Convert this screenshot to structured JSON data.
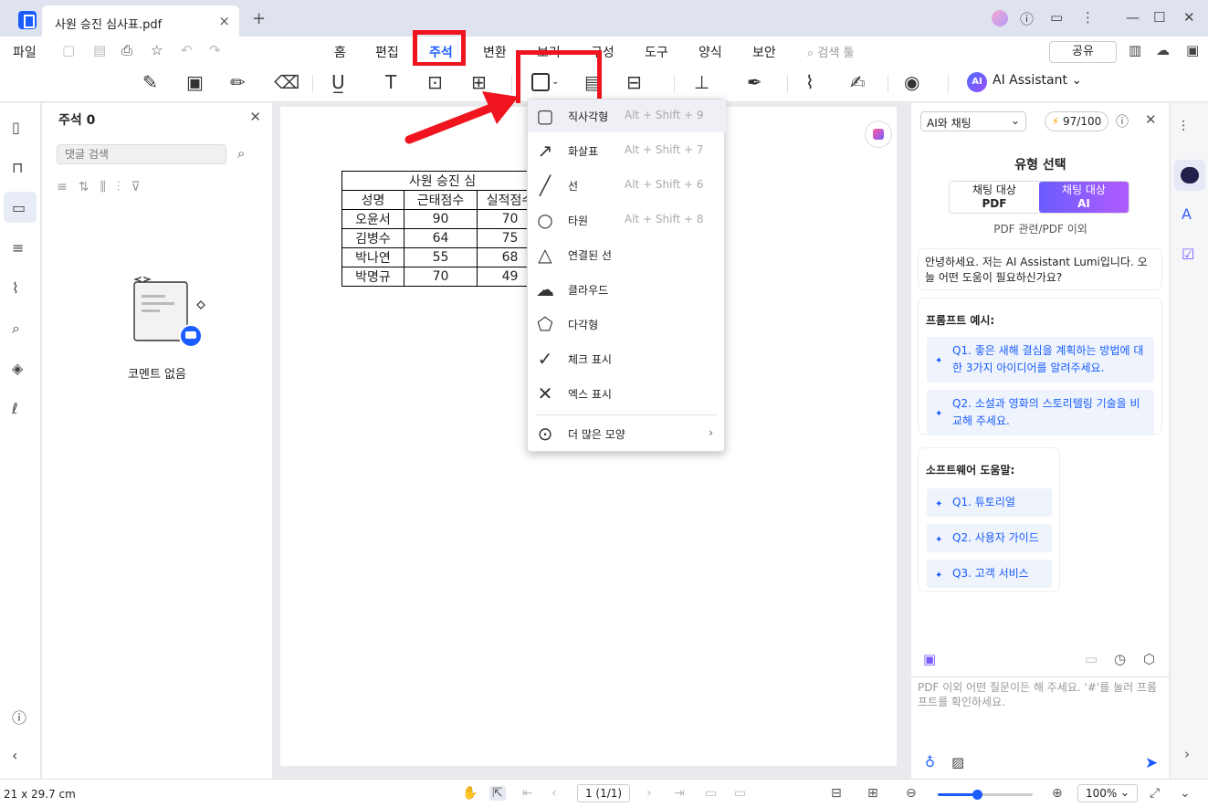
{
  "titlebar": {
    "tab_title": "사원 승진 심사표.pdf",
    "close": "×",
    "new_tab": "+"
  },
  "menubar": {
    "file": "파일",
    "items": [
      "홈",
      "편집",
      "주석",
      "변환",
      "보기",
      "구성",
      "도구",
      "양식",
      "보안"
    ],
    "active": "주석",
    "search_tools": "검색 툴",
    "share": "공유"
  },
  "toolbar": {
    "ai_assistant": "AI Assistant",
    "ai_badge": "AI"
  },
  "comments_panel": {
    "title": "주석 0",
    "search_placeholder": "댓글 검색",
    "empty_text": "코멘트 없음"
  },
  "document": {
    "table_title": "사원 승진 심",
    "headers": [
      "성명",
      "근태점수",
      "실적점수"
    ],
    "rows": [
      [
        "오윤서",
        "90",
        "70"
      ],
      [
        "김병수",
        "64",
        "75"
      ],
      [
        "박나연",
        "55",
        "68"
      ],
      [
        "박명규",
        "70",
        "49"
      ]
    ]
  },
  "shape_menu": {
    "items": [
      {
        "label": "직사각형",
        "shortcut": "Alt + Shift + 9",
        "icon": "rectangle-icon"
      },
      {
        "label": "화살표",
        "shortcut": "Alt + Shift + 7",
        "icon": "arrow-icon"
      },
      {
        "label": "선",
        "shortcut": "Alt + Shift + 6",
        "icon": "line-icon"
      },
      {
        "label": "타원",
        "shortcut": "Alt + Shift + 8",
        "icon": "ellipse-icon"
      },
      {
        "label": "연결된 선",
        "shortcut": "",
        "icon": "polyline-icon"
      },
      {
        "label": "클라우드",
        "shortcut": "",
        "icon": "cloud-icon"
      },
      {
        "label": "다각형",
        "shortcut": "",
        "icon": "polygon-icon"
      },
      {
        "label": "체크 표시",
        "shortcut": "",
        "icon": "check-icon"
      },
      {
        "label": "엑스 표시",
        "shortcut": "",
        "icon": "cross-icon"
      }
    ],
    "more": "더 많은 모양"
  },
  "ai_panel": {
    "mode": "AI와 채팅",
    "credits": "97/100",
    "title": "유형 선택",
    "seg_pdf_line1": "채팅 대상",
    "seg_pdf_line2": "PDF",
    "seg_ai_line1": "채팅 대상",
    "seg_ai_line2": "AI",
    "seg_sub": "PDF 관련/PDF 이외",
    "greeting": "안녕하세요. 저는 AI Assistant Lumi입니다. 오늘 어떤 도움이 필요하신가요?",
    "prompt_title": "프롬프트 예시:",
    "prompts": [
      "Q1. 좋은 새해 결심을 계획하는 방법에 대한 3가지 아이디어를 알려주세요.",
      "Q2. 소설과 영화의 스토리텔링 기술을 비교해 주세요."
    ],
    "help_title": "소프트웨어 도움말:",
    "help_items": [
      "Q1. 튜토리얼",
      "Q2. 사용자 가이드",
      "Q3. 고객 서비스"
    ],
    "input_placeholder": "PDF 이외 어떤 질문이든 해 주세요. '#'를 눌러 프롬프트를 확인하세요."
  },
  "statusbar": {
    "page_size": "21 x 29.7 cm",
    "page_num": "1 (1/1)",
    "zoom": "100%",
    "zoom_fraction": 0.41
  },
  "colors": {
    "accent": "#1a5cff",
    "highlight_red": "#f0141e"
  }
}
